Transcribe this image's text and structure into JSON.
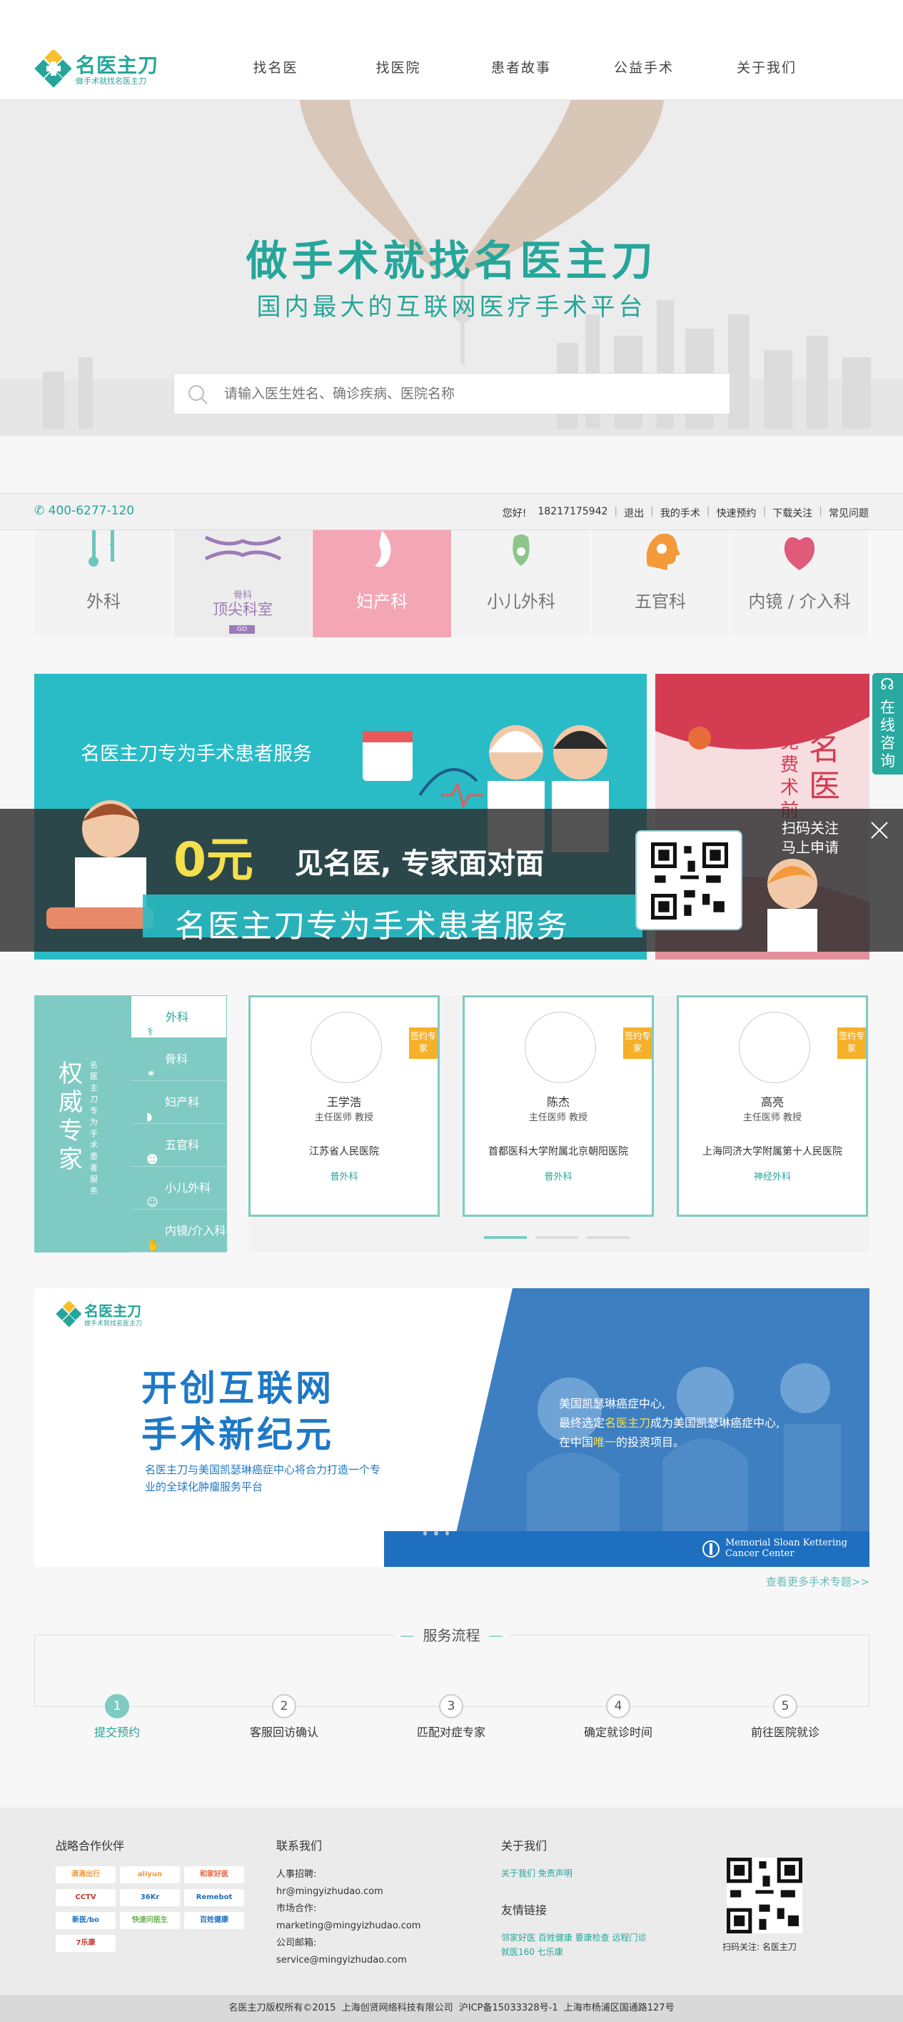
{
  "header": {
    "logo_name": "名医主刀",
    "logo_sub": "做手术就找名医主刀",
    "nav": [
      "找名医",
      "找医院",
      "患者故事",
      "公益手术",
      "关于我们"
    ]
  },
  "hero": {
    "title": "做手术就找名医主刀",
    "subtitle": "国内最大的互联网医疗手术平台",
    "search_placeholder": "请输入医生姓名、确诊疾病、医院名称"
  },
  "infobar": {
    "phone": "400-6277-120",
    "greeting": "您好!",
    "user_phone": "18217175942",
    "links": [
      "退出",
      "我的手术",
      "快速预约",
      "下载关注",
      "常见问题"
    ]
  },
  "categories": [
    {
      "label": "外科",
      "state": "normal"
    },
    {
      "label": "顶尖科室",
      "tag_small": "骨科",
      "go": "GO",
      "state": "sel"
    },
    {
      "label": "妇产科",
      "state": "active"
    },
    {
      "label": "小儿外科",
      "state": "normal"
    },
    {
      "label": "五官科",
      "state": "normal"
    },
    {
      "label": "内镜 / 介入科",
      "state": "normal"
    }
  ],
  "banner": {
    "left_text": "名医主刀专为手术患者服务",
    "right_text": "免费术前",
    "right_big": "名医"
  },
  "promo": {
    "zero": "0元",
    "main": "见名医, 专家面对面",
    "strip": "名医主刀专为手术患者服务",
    "hint_line1": "扫码关注",
    "hint_line2": "马上申请"
  },
  "side_consult": "在线咨询",
  "experts": {
    "side_title": "权威专家",
    "side_sub": "名医主刀专为手术患者服务",
    "menu": [
      "外科",
      "骨科",
      "妇产科",
      "五官科",
      "小儿外科",
      "内镜/介入科"
    ],
    "badge": "签约专家",
    "cards": [
      {
        "name": "王学浩",
        "title": "主任医师 教授",
        "hospital": "江苏省人民医院",
        "dept": "普外科"
      },
      {
        "name": "陈杰",
        "title": "主任医师 教授",
        "hospital": "首都医科大学附属北京朝阳医院",
        "dept": "普外科"
      },
      {
        "name": "高亮",
        "title": "主任医师 教授",
        "hospital": "上海同济大学附属第十人民医院",
        "dept": "神经外科"
      }
    ]
  },
  "feature": {
    "logo_name": "名医主刀",
    "logo_sub": "做手术就找名医主刀",
    "head1": "开创互联网",
    "head2": "手术新纪元",
    "body": "名医主刀与美国凯瑟琳癌症中心将合力打造一个专业的全球化肿瘤服务平台",
    "quote_line1": "美国凯瑟琳癌症中心,",
    "quote_line2_a": "最终选定",
    "quote_line2_hl": "名医主刀",
    "quote_line2_b": "成为美国凯瑟琳癌症中心,",
    "quote_line3_a": "在中国",
    "quote_line3_hl": "唯一",
    "quote_line3_b": "的投资项目。",
    "msk_line1": "Memorial Sloan Kettering",
    "msk_line2": "Cancer Center",
    "more": "查看更多手术专题>>"
  },
  "process": {
    "title": "服务流程",
    "steps": [
      {
        "num": "1",
        "label": "提交预约"
      },
      {
        "num": "2",
        "label": "客服回访确认"
      },
      {
        "num": "3",
        "label": "匹配对症专家"
      },
      {
        "num": "4",
        "label": "确定就诊时间"
      },
      {
        "num": "5",
        "label": "前往医院就诊"
      }
    ]
  },
  "footer": {
    "partners_title": "战略合作伙伴",
    "partners": [
      "滴滴出行",
      "aliyun",
      "和家好医",
      "CCTV",
      "36Kr",
      "Remebot",
      "新医/bo",
      "快速问医生",
      "百姓健康",
      "7乐康"
    ],
    "contact_title": "联系我们",
    "contact": [
      {
        "label": "人事招聘:",
        "value": "hr@mingyizhudao.com"
      },
      {
        "label": "市场合作:",
        "value": "marketing@mingyizhudao.com"
      },
      {
        "label": "公司邮箱:",
        "value": "service@mingyizhudao.com"
      }
    ],
    "about_title": "关于我们",
    "about_links": "关于我们 免责声明",
    "friends_title": "友情链接",
    "friends_line1": "邻家好医 百姓健康 要康检查 远程门诊",
    "friends_line2": "就医160 七乐康",
    "qr_caption": "扫码关注: 名医主刀",
    "copyright": "名医主刀版权所有©2015   上海创贤网络科技有限公司   沪ICP备15033328号-1   上海市杨浦区国通路127号"
  }
}
